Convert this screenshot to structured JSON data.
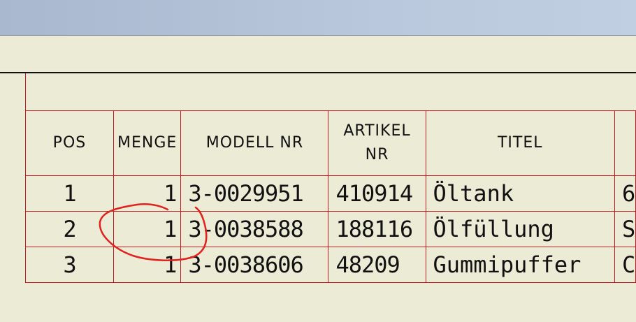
{
  "bom": {
    "headers": {
      "pos": "POS",
      "menge": "MENGE",
      "modell_nr": "MODELL NR",
      "artikel_line1": "ARTIKEL",
      "artikel_line2": "NR",
      "titel": "TITEL",
      "extra": ""
    },
    "rows": [
      {
        "pos": "1",
        "menge": "1",
        "modell_nr": "3-0029951",
        "artikel_nr": "410914",
        "titel": "Öltank",
        "extra": "6"
      },
      {
        "pos": "2",
        "menge": "1",
        "modell_nr": "3-0038588",
        "artikel_nr": "188116",
        "titel": "Ölfüllung",
        "extra": "S"
      },
      {
        "pos": "3",
        "menge": "1",
        "modell_nr": "3-0038606",
        "artikel_nr": "48209",
        "titel": "Gummipuffer",
        "extra": "C"
      }
    ]
  },
  "annotation": {
    "color": "#e0221f",
    "shape": "freehand-circle",
    "target": "row 2 MENGE"
  },
  "colors": {
    "background": "#ecebd6",
    "grid_line": "#c41a22",
    "titlebar": "#bac8dd",
    "text": "#111111"
  }
}
